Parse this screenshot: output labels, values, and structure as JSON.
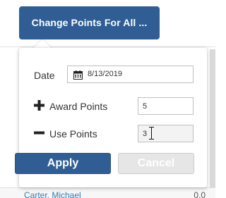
{
  "trigger_button": {
    "label": "Change Points For All ..."
  },
  "popover": {
    "date": {
      "label": "Date",
      "value": "8/13/2019",
      "icon": "calendar-icon"
    },
    "award_points": {
      "label": "Award Points",
      "value": "5",
      "icon": "plus-icon"
    },
    "use_points": {
      "label": "Use Points",
      "value": "3",
      "icon": "minus-icon"
    },
    "apply_label": "Apply",
    "cancel_label": "Cancel"
  },
  "background_row": {
    "name": "Carter, Michael",
    "value": "0.0"
  },
  "colors": {
    "primary": "#305e94",
    "cancel_disabled": "#e6e6e6",
    "link": "#337ab7"
  }
}
